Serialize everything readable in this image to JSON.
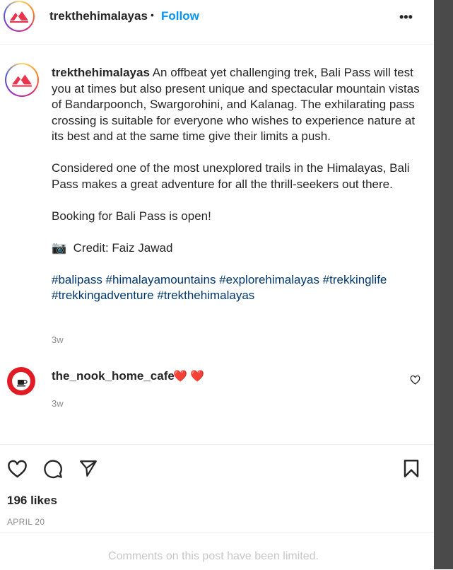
{
  "post": {
    "author": "trekthehimalayas",
    "separator": "•",
    "follow_label": "Follow",
    "more_icon": "more-options-icon",
    "more_glyph": "•••"
  },
  "caption": {
    "username": "trekthehimalayas",
    "paragraph1": "An offbeat yet challenging trek, Bali Pass will test you at times but also present unique and spectacular mountain vistas of Bandarpoonch, Swargorohini, and Kalanag. The exhilarating pass crossing is suitable for everyone who wishes to experience nature at its best and at the same time give their limits a push.",
    "paragraph2": "Considered one of the most unexplored trails in the Himalayas, Bali Pass makes a great adventure for all the thrill-seekers out there.",
    "paragraph3": "Booking for Bali Pass is open!",
    "credit_emoji": "📷",
    "credit": "Credit: Faiz Jawad",
    "hashtags": "#balipass #himalayamountains #explorehimalayas #trekkinglife #trekkingadventure #trekthehimalayas",
    "time": "3w"
  },
  "comment": {
    "username": "the_nook_home_cafe",
    "text": "❤️ ❤️",
    "time": "3w"
  },
  "engagement": {
    "likes": "196 likes",
    "date": "APRIL 20",
    "limited_notice": "Comments on this post have been limited."
  },
  "colors": {
    "follow": "#0095f6",
    "hashtag": "#00376b",
    "muted": "#8e8e8e",
    "heart": "#e41e3f",
    "cafe_brand": "#e01b24"
  }
}
